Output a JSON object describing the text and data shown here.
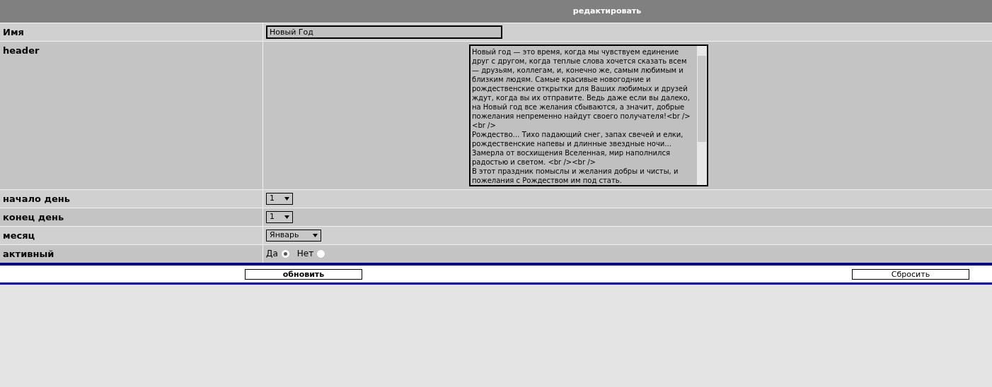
{
  "title": "редактировать",
  "fields": [
    {
      "kind": "text",
      "label": "Имя",
      "value": "Новый Год"
    },
    {
      "kind": "textarea",
      "label": "header",
      "value": "Новый год — это время, когда мы чувствуем единение друг с другом, когда теплые слова хочется сказать всем — друзьям, коллегам, и, конечно же, самым любимым и близким людям. Самые красивые новогодние и рождественские открытки для Ваших любимых и друзей ждут, когда вы их отправите. Ведь даже если вы далеко, на Новый год все желания сбываются, а значит, добрые пожелания непременно найдут своего получателя!<br /><br />\nРождество… Тихо падающий снег, запах свечей и елки, рождественские напевы и длинные звездные ночи... Замерла от восхищения Вселенная, мир наполнился радостью и светом. <br /><br />\nВ этот праздник помыслы и желания добры и чисты, и пожелания с Рождеством им под стать."
    },
    {
      "kind": "select",
      "label": "начало день",
      "value": "1"
    },
    {
      "kind": "select",
      "label": "конец день",
      "value": "1"
    },
    {
      "kind": "select",
      "label": "месяц",
      "value": "Январь"
    },
    {
      "kind": "radio",
      "label": "активный",
      "options": [
        {
          "label": "Да",
          "selected": true
        },
        {
          "label": "Нет",
          "selected": false
        }
      ]
    }
  ],
  "buttons": [
    {
      "label": "обновить",
      "bold": true
    },
    {
      "label": "Сбросить",
      "bold": false
    }
  ]
}
